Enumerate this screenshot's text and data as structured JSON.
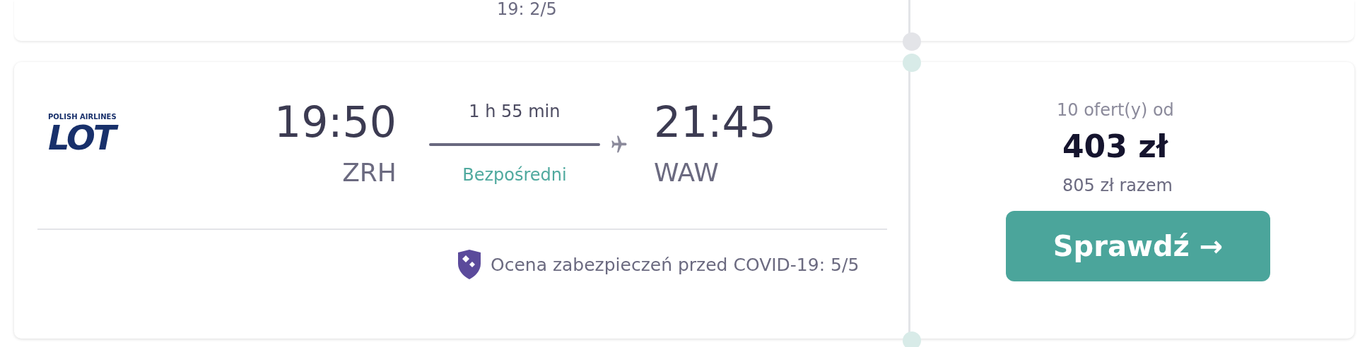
{
  "previous_card": {
    "covid_rating": "19: 2/5"
  },
  "flight": {
    "airline_logo": {
      "small": "POLISH AIRLINES",
      "big": "LOT"
    },
    "departure": {
      "time": "19:50",
      "airport": "ZRH"
    },
    "duration": "1 h 55 min",
    "stops": "Bezpośredni",
    "arrival": {
      "time": "21:45",
      "airport": "WAW"
    },
    "covid_rating": "Ocena zabezpieczeń przed COVID-19: 5/5"
  },
  "price": {
    "offers": "10 ofert(y) od",
    "amount": "403 zł",
    "total": "805 zł razem",
    "button": "Sprawdź →"
  }
}
